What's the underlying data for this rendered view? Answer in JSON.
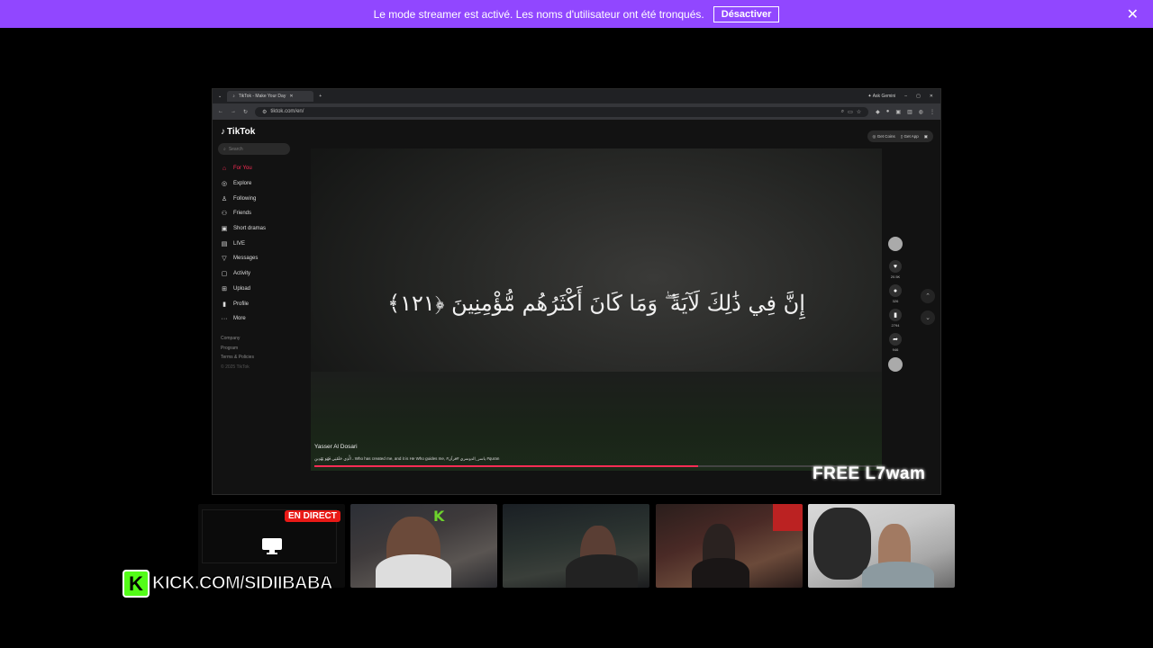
{
  "banner": {
    "message": "Le mode streamer est activé. Les noms d'utilisateur ont été tronqués.",
    "button_label": "Désactiver",
    "close_icon": "close-icon",
    "color": "#9147ff"
  },
  "browser": {
    "tab_title": "TikTok - Make Your Day",
    "new_tab": "+",
    "ask_gemini": "Ask Gemini",
    "url": "tiktok.com/en/"
  },
  "tiktok": {
    "logo": "TikTok",
    "search_placeholder": "Search",
    "nav": [
      {
        "label": "For You",
        "icon": "⌂",
        "active": true
      },
      {
        "label": "Explore",
        "icon": "◎",
        "active": false
      },
      {
        "label": "Following",
        "icon": "♙",
        "active": false
      },
      {
        "label": "Friends",
        "icon": "⚇",
        "active": false
      },
      {
        "label": "Short dramas",
        "icon": "▣",
        "active": false
      },
      {
        "label": "LIVE",
        "icon": "▤",
        "active": false
      },
      {
        "label": "Messages",
        "icon": "▽",
        "active": false
      },
      {
        "label": "Activity",
        "icon": "▢",
        "active": false
      },
      {
        "label": "Upload",
        "icon": "⊞",
        "active": false
      },
      {
        "label": "Profile",
        "icon": "▮",
        "active": false
      },
      {
        "label": "More",
        "icon": "···",
        "active": false
      }
    ],
    "footer": {
      "company": "Company",
      "program": "Program",
      "terms": "Terms & Policies",
      "copyright": "© 2025 TikTok"
    },
    "top_right": {
      "get_coins": "Get Coins",
      "get_app": "Get App"
    },
    "video": {
      "verse": "إِنَّ فِي ذَٰلِكَ لَآيَةً ۖ وَمَا كَانَ أَكْثَرُهُم مُّؤْمِنِينَ ﴿١٢١﴾",
      "author": "Yasser Al Dosari",
      "caption": "الَّذِي خَلَقَنِي فَهُوَ يَهْدِينِ ، Who has created me, and it is He Who guides me, #ياسر_الدوسري #قرآن #quran",
      "progress": 0.68
    },
    "actions": {
      "likes": "20.5K",
      "comments": "326",
      "saves": "2794",
      "shares": "946"
    },
    "accent": "#fe2c55"
  },
  "overlay": {
    "free_text": "FREE L7wam",
    "live_badge": "EN DIRECT",
    "kick_url": "KICK.COM/SIDIIBABA",
    "kick_logo": "K",
    "kick_color": "#53fc18"
  }
}
